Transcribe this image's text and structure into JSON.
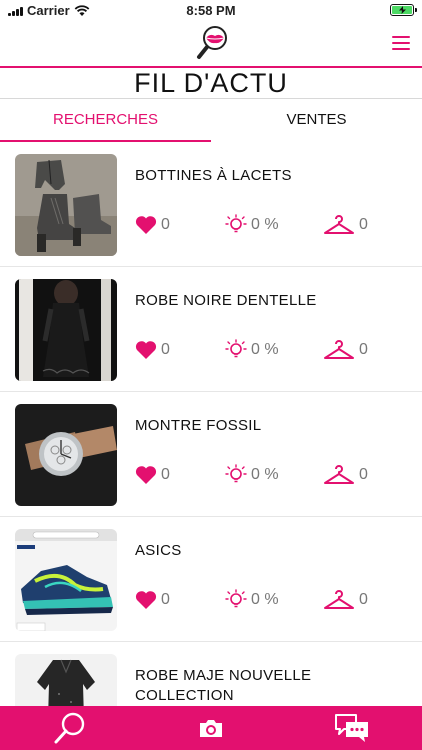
{
  "status_bar": {
    "carrier": "Carrier",
    "time": "8:58 PM"
  },
  "colors": {
    "accent": "#e3106f",
    "battery": "#4cd964"
  },
  "header": {
    "logo_icon": "magnifier-lips-logo-icon",
    "menu_icon": "hamburger-menu-icon",
    "title": "FIL D'ACTU"
  },
  "tabs": [
    {
      "label": "RECHERCHES",
      "active": true
    },
    {
      "label": "VENTES",
      "active": false
    }
  ],
  "feed": {
    "items": [
      {
        "title": "BOTTINES À LACETS",
        "likes": "0",
        "ideas": "0 %",
        "hangers": "0",
        "image": "ankle-boots-photo"
      },
      {
        "title": "ROBE NOIRE DENTELLE",
        "likes": "0",
        "ideas": "0 %",
        "hangers": "0",
        "image": "black-lace-dress-photo"
      },
      {
        "title": "MONTRE FOSSIL",
        "likes": "0",
        "ideas": "0 %",
        "hangers": "0",
        "image": "watch-photo"
      },
      {
        "title": "ASICS",
        "likes": "0",
        "ideas": "0 %",
        "hangers": "0",
        "image": "sneaker-photo"
      },
      {
        "title": "ROBE MAJE NOUVELLE COLLECTION",
        "image": "maje-dress-photo"
      }
    ]
  },
  "bottom_bar": {
    "items": [
      "search-icon",
      "camera-icon",
      "chat-icon"
    ]
  }
}
